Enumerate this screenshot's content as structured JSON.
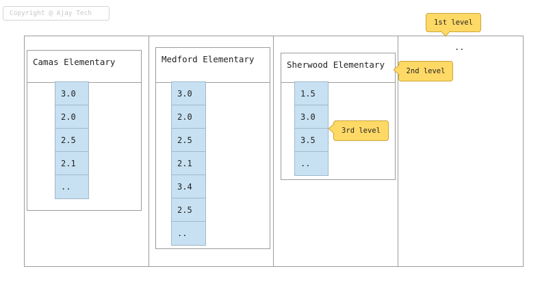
{
  "copyright": "Copyright @ Ajay Tech",
  "top_level_items": [
    "Camas Elementary",
    "Medford Elementary",
    "Sherwood Elementary",
    ".."
  ],
  "schools": [
    {
      "name": "Camas Elementary",
      "values": [
        "3.0",
        "2.0",
        "2.5",
        "2.1",
        ".."
      ]
    },
    {
      "name": "Medford Elementary",
      "values": [
        "3.0",
        "2.0",
        "2.5",
        "2.1",
        "3.4",
        "2.5",
        ".."
      ]
    },
    {
      "name": "Sherwood Elementary",
      "values": [
        "1.5",
        "3.0",
        "3.5",
        ".."
      ]
    }
  ],
  "more_indicator": "..",
  "callouts": {
    "first_level": "1st level",
    "second_level": "2nd level",
    "third_level": "3rd level"
  },
  "colors": {
    "cell_fill": "#c7e1f2",
    "callout_fill": "#ffd966",
    "border": "#9a9a9a"
  }
}
